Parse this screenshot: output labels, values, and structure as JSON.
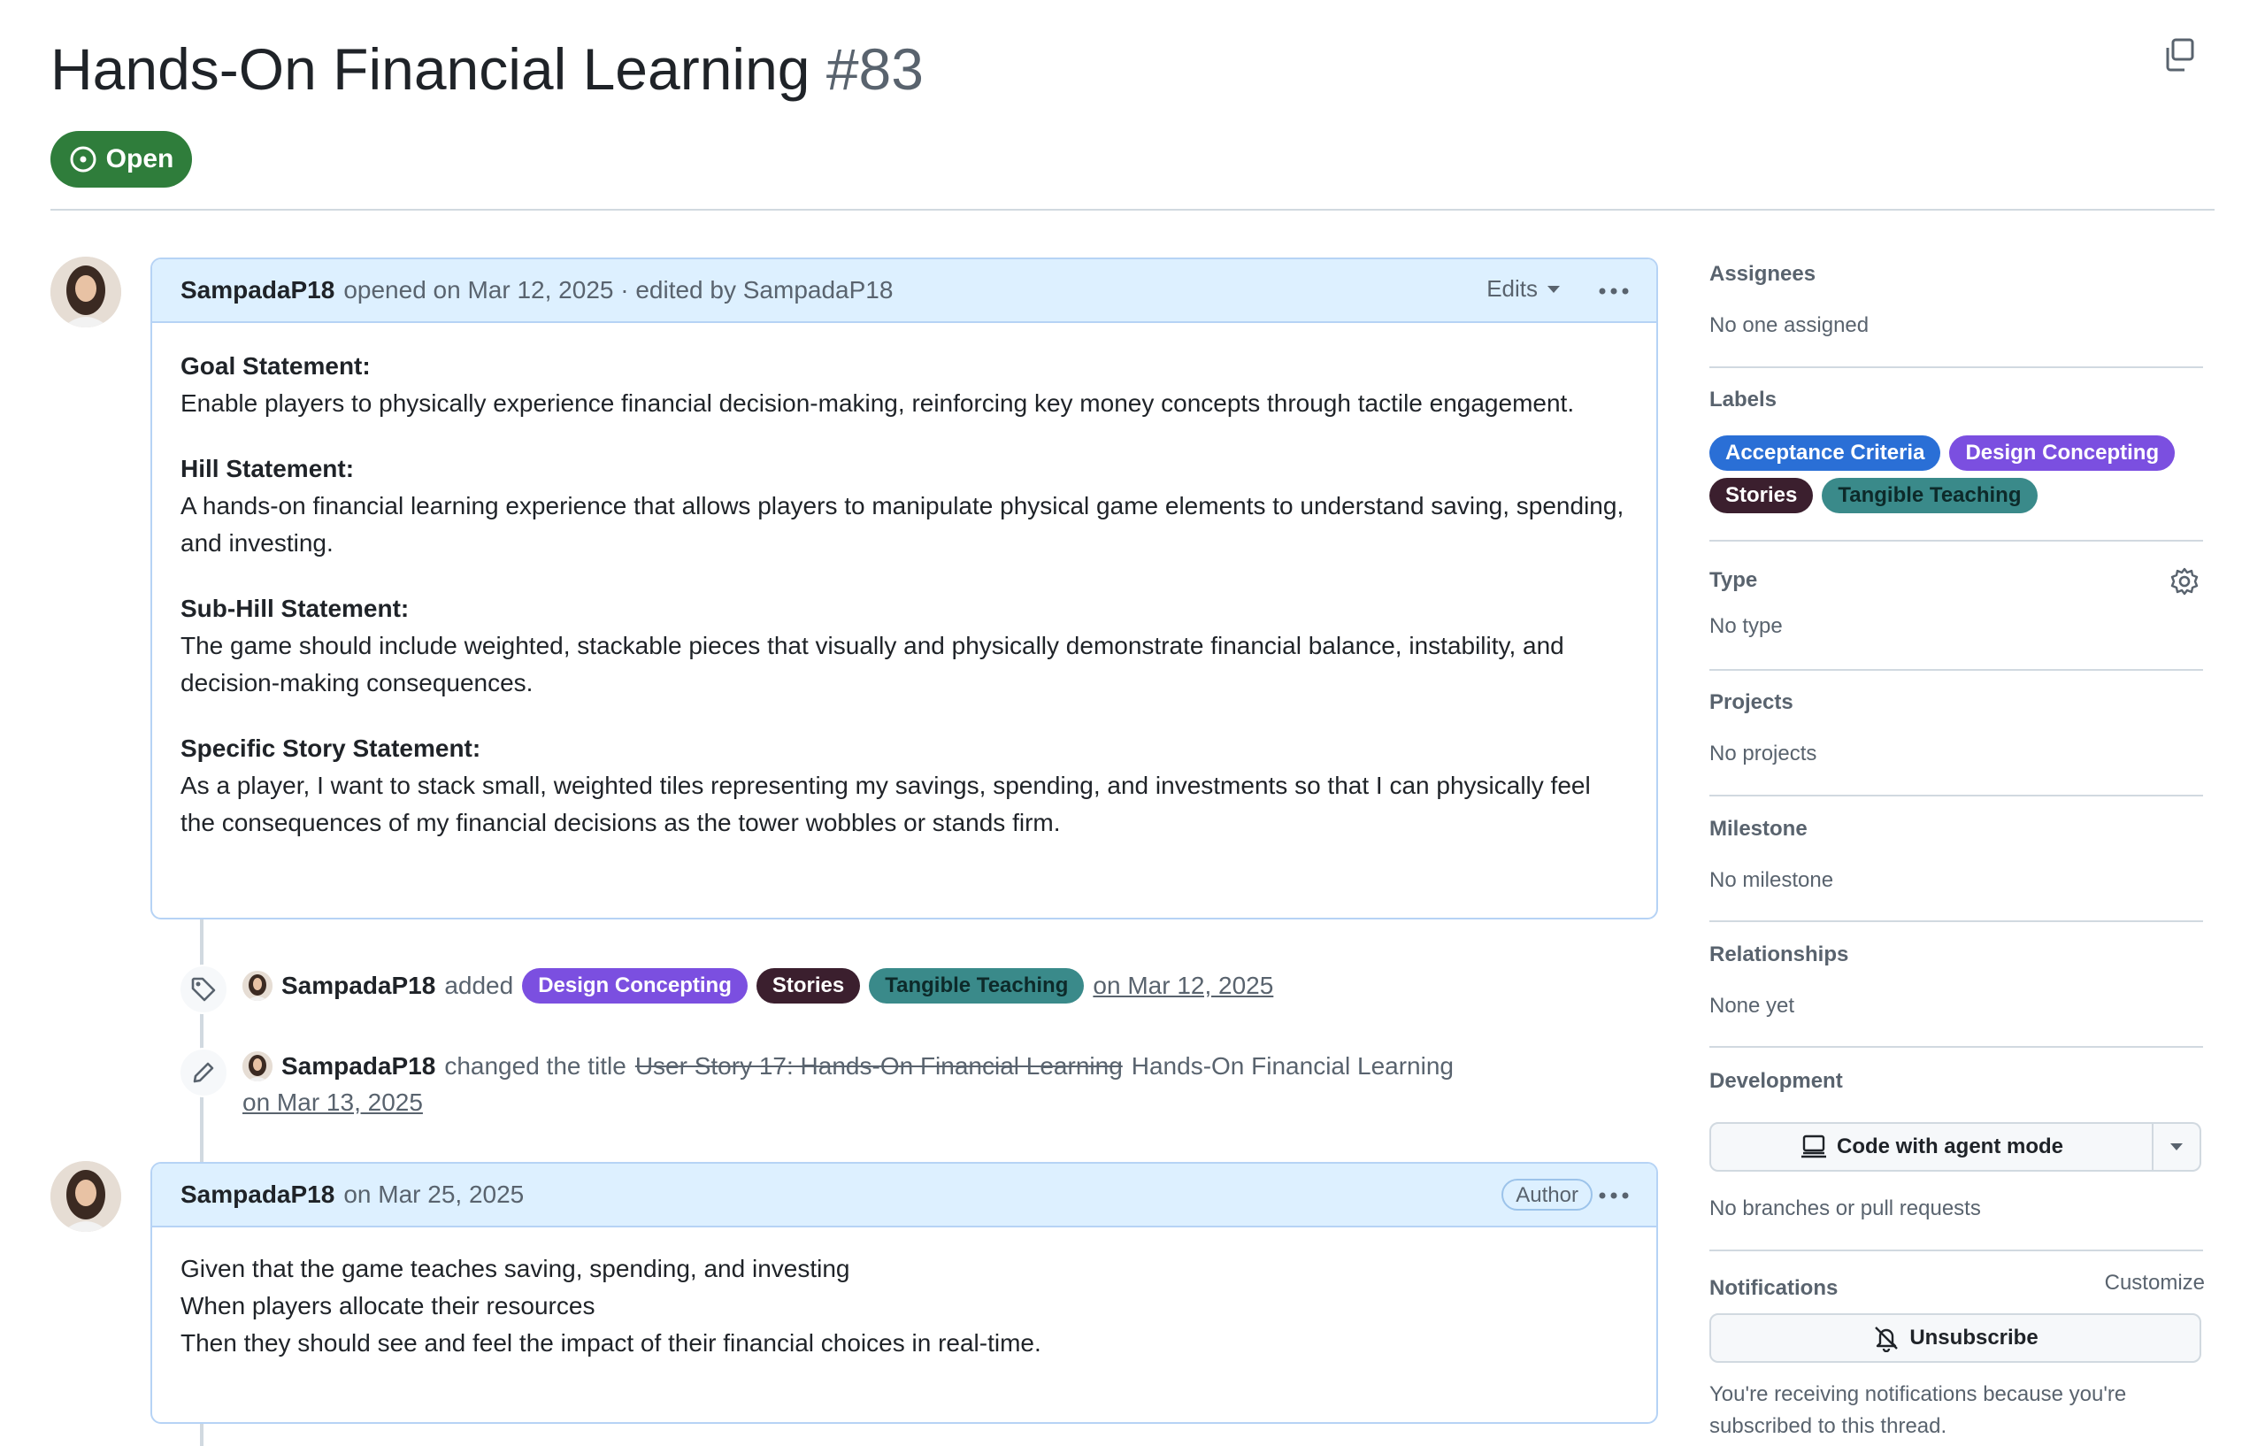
{
  "issue": {
    "title": "Hands-On Financial Learning",
    "number": "#83",
    "state": "Open"
  },
  "main_comment": {
    "author": "SampadaP18",
    "meta": "opened on Mar 12, 2025 · edited by SampadaP18",
    "edits_label": "Edits",
    "sections": [
      {
        "heading": "Goal Statement:",
        "text": "Enable players to physically experience financial decision-making, reinforcing key money concepts through tactile engagement."
      },
      {
        "heading": "Hill Statement:",
        "text": "A hands-on financial learning experience that allows players to manipulate physical game elements to understand saving, spending, and investing."
      },
      {
        "heading": "Sub-Hill Statement:",
        "text": "The game should include weighted, stackable pieces that visually and physically demonstrate financial balance, instability, and decision-making consequences."
      },
      {
        "heading": "Specific Story Statement:",
        "text": "As a player, I want to stack small, weighted tiles representing my savings, spending, and investments so that I can physically feel the consequences of my financial decisions as the tower wobbles or stands firm."
      }
    ]
  },
  "timeline": {
    "label_event": {
      "actor": "SampadaP18",
      "action": "added",
      "labels": [
        "Design Concepting",
        "Stories",
        "Tangible Teaching"
      ],
      "date": "on Mar 12, 2025"
    },
    "rename_event": {
      "actor": "SampadaP18",
      "action": "changed the title",
      "old_title": "User Story 17: Hands-On Financial Learning",
      "new_title": "Hands-On Financial Learning",
      "date": "on Mar 13, 2025"
    }
  },
  "second_comment": {
    "author": "SampadaP18",
    "meta": "on Mar 25, 2025",
    "badge": "Author",
    "lines": [
      "Given that the game teaches saving, spending, and investing",
      "When players allocate their resources",
      "Then they should see and feel the impact of their financial choices in real-time."
    ]
  },
  "sidebar": {
    "assignees": {
      "heading": "Assignees",
      "value": "No one assigned"
    },
    "labels": {
      "heading": "Labels",
      "items": [
        "Acceptance Criteria",
        "Design Concepting",
        "Stories",
        "Tangible Teaching"
      ]
    },
    "type": {
      "heading": "Type",
      "value": "No type"
    },
    "projects": {
      "heading": "Projects",
      "value": "No projects"
    },
    "milestone": {
      "heading": "Milestone",
      "value": "No milestone"
    },
    "relationships": {
      "heading": "Relationships",
      "value": "None yet"
    },
    "development": {
      "heading": "Development",
      "button_label": "Code with agent mode",
      "value": "No branches or pull requests"
    },
    "notifications": {
      "heading": "Notifications",
      "customize": "Customize",
      "button_label": "Unsubscribe",
      "note": "You're receiving notifications because you're subscribed to this thread."
    }
  },
  "colors": {
    "open_green": "#2f7d3b",
    "label_acceptance": "#2a6fd6",
    "label_design": "#7b4fe0",
    "label_stories": "#3b1f2e",
    "label_tangible": "#3a8a8a",
    "header_bg": "#ddf0ff"
  }
}
